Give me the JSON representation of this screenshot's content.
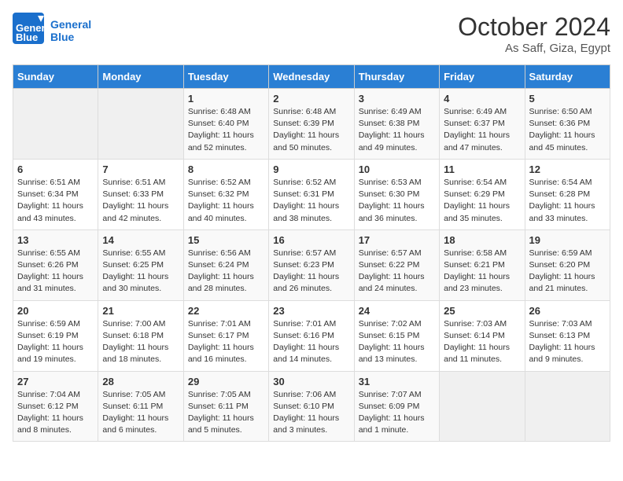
{
  "logo": {
    "line1": "General",
    "line2": "Blue"
  },
  "title": "October 2024",
  "subtitle": "As Saff, Giza, Egypt",
  "days_of_week": [
    "Sunday",
    "Monday",
    "Tuesday",
    "Wednesday",
    "Thursday",
    "Friday",
    "Saturday"
  ],
  "weeks": [
    [
      null,
      null,
      {
        "day": 1,
        "sunrise": "6:48 AM",
        "sunset": "6:40 PM",
        "daylight": "11 hours and 52 minutes."
      },
      {
        "day": 2,
        "sunrise": "6:48 AM",
        "sunset": "6:39 PM",
        "daylight": "11 hours and 50 minutes."
      },
      {
        "day": 3,
        "sunrise": "6:49 AM",
        "sunset": "6:38 PM",
        "daylight": "11 hours and 49 minutes."
      },
      {
        "day": 4,
        "sunrise": "6:49 AM",
        "sunset": "6:37 PM",
        "daylight": "11 hours and 47 minutes."
      },
      {
        "day": 5,
        "sunrise": "6:50 AM",
        "sunset": "6:36 PM",
        "daylight": "11 hours and 45 minutes."
      }
    ],
    [
      {
        "day": 6,
        "sunrise": "6:51 AM",
        "sunset": "6:34 PM",
        "daylight": "11 hours and 43 minutes."
      },
      {
        "day": 7,
        "sunrise": "6:51 AM",
        "sunset": "6:33 PM",
        "daylight": "11 hours and 42 minutes."
      },
      {
        "day": 8,
        "sunrise": "6:52 AM",
        "sunset": "6:32 PM",
        "daylight": "11 hours and 40 minutes."
      },
      {
        "day": 9,
        "sunrise": "6:52 AM",
        "sunset": "6:31 PM",
        "daylight": "11 hours and 38 minutes."
      },
      {
        "day": 10,
        "sunrise": "6:53 AM",
        "sunset": "6:30 PM",
        "daylight": "11 hours and 36 minutes."
      },
      {
        "day": 11,
        "sunrise": "6:54 AM",
        "sunset": "6:29 PM",
        "daylight": "11 hours and 35 minutes."
      },
      {
        "day": 12,
        "sunrise": "6:54 AM",
        "sunset": "6:28 PM",
        "daylight": "11 hours and 33 minutes."
      }
    ],
    [
      {
        "day": 13,
        "sunrise": "6:55 AM",
        "sunset": "6:26 PM",
        "daylight": "11 hours and 31 minutes."
      },
      {
        "day": 14,
        "sunrise": "6:55 AM",
        "sunset": "6:25 PM",
        "daylight": "11 hours and 30 minutes."
      },
      {
        "day": 15,
        "sunrise": "6:56 AM",
        "sunset": "6:24 PM",
        "daylight": "11 hours and 28 minutes."
      },
      {
        "day": 16,
        "sunrise": "6:57 AM",
        "sunset": "6:23 PM",
        "daylight": "11 hours and 26 minutes."
      },
      {
        "day": 17,
        "sunrise": "6:57 AM",
        "sunset": "6:22 PM",
        "daylight": "11 hours and 24 minutes."
      },
      {
        "day": 18,
        "sunrise": "6:58 AM",
        "sunset": "6:21 PM",
        "daylight": "11 hours and 23 minutes."
      },
      {
        "day": 19,
        "sunrise": "6:59 AM",
        "sunset": "6:20 PM",
        "daylight": "11 hours and 21 minutes."
      }
    ],
    [
      {
        "day": 20,
        "sunrise": "6:59 AM",
        "sunset": "6:19 PM",
        "daylight": "11 hours and 19 minutes."
      },
      {
        "day": 21,
        "sunrise": "7:00 AM",
        "sunset": "6:18 PM",
        "daylight": "11 hours and 18 minutes."
      },
      {
        "day": 22,
        "sunrise": "7:01 AM",
        "sunset": "6:17 PM",
        "daylight": "11 hours and 16 minutes."
      },
      {
        "day": 23,
        "sunrise": "7:01 AM",
        "sunset": "6:16 PM",
        "daylight": "11 hours and 14 minutes."
      },
      {
        "day": 24,
        "sunrise": "7:02 AM",
        "sunset": "6:15 PM",
        "daylight": "11 hours and 13 minutes."
      },
      {
        "day": 25,
        "sunrise": "7:03 AM",
        "sunset": "6:14 PM",
        "daylight": "11 hours and 11 minutes."
      },
      {
        "day": 26,
        "sunrise": "7:03 AM",
        "sunset": "6:13 PM",
        "daylight": "11 hours and 9 minutes."
      }
    ],
    [
      {
        "day": 27,
        "sunrise": "7:04 AM",
        "sunset": "6:12 PM",
        "daylight": "11 hours and 8 minutes."
      },
      {
        "day": 28,
        "sunrise": "7:05 AM",
        "sunset": "6:11 PM",
        "daylight": "11 hours and 6 minutes."
      },
      {
        "day": 29,
        "sunrise": "7:05 AM",
        "sunset": "6:11 PM",
        "daylight": "11 hours and 5 minutes."
      },
      {
        "day": 30,
        "sunrise": "7:06 AM",
        "sunset": "6:10 PM",
        "daylight": "11 hours and 3 minutes."
      },
      {
        "day": 31,
        "sunrise": "7:07 AM",
        "sunset": "6:09 PM",
        "daylight": "11 hours and 1 minute."
      },
      null,
      null
    ]
  ]
}
